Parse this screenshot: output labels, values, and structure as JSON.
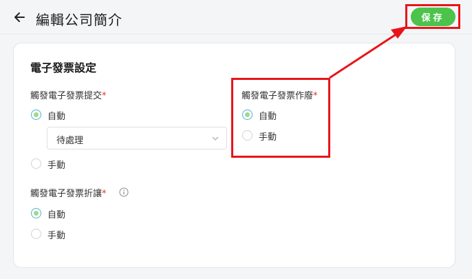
{
  "header": {
    "title": "編輯公司簡介",
    "save_label": "保存",
    "back_icon": "arrow-left-icon"
  },
  "card": {
    "title": "電子發票設定",
    "groups": [
      {
        "label": "觸發電子發票提交",
        "required_mark": "*",
        "options": [
          {
            "label": "自動",
            "checked": true
          },
          {
            "label": "手動",
            "checked": false
          }
        ],
        "select": {
          "value": "待處理"
        }
      },
      {
        "label": "觸發電子發票作廢",
        "required_mark": "*",
        "options": [
          {
            "label": "自動",
            "checked": true
          },
          {
            "label": "手動",
            "checked": false
          }
        ]
      },
      {
        "label": "觸發電子發票折讓",
        "required_mark": "*",
        "info_icon": "info-icon",
        "options": [
          {
            "label": "自動",
            "checked": true
          },
          {
            "label": "手動",
            "checked": false
          }
        ]
      }
    ]
  },
  "colors": {
    "save": "#4cc34b",
    "annotation": "#e8141a",
    "radio_selected": "#9fd88f"
  }
}
